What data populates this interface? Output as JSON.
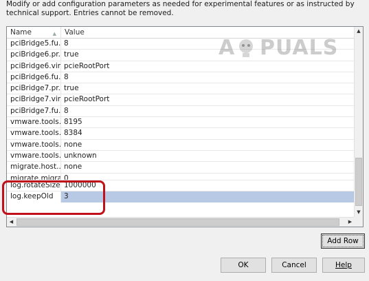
{
  "description": "Modify or add configuration parameters as needed for experimental features or as instructed by technical support. Entries cannot be removed.",
  "columns": {
    "name": "Name",
    "value": "Value"
  },
  "rows": [
    {
      "name": "pciBridge5.fu...",
      "value": "8"
    },
    {
      "name": "pciBridge6.pr...",
      "value": "true"
    },
    {
      "name": "pciBridge6.vir...",
      "value": "pcieRootPort"
    },
    {
      "name": "pciBridge6.fu...",
      "value": "8"
    },
    {
      "name": "pciBridge7.pr...",
      "value": "true"
    },
    {
      "name": "pciBridge7.vir...",
      "value": "pcieRootPort"
    },
    {
      "name": "pciBridge7.fu...",
      "value": "8"
    },
    {
      "name": "vmware.tools....",
      "value": "8195"
    },
    {
      "name": "vmware.tools....",
      "value": "8384"
    },
    {
      "name": "vmware.tools....",
      "value": "none"
    },
    {
      "name": "vmware.tools....",
      "value": "unknown"
    },
    {
      "name": "migrate.host...",
      "value": "none"
    },
    {
      "name": "migrate.migra...",
      "value": "0"
    },
    {
      "name": "log.rotateSize",
      "value": "1000000"
    },
    {
      "name": "log.keepOld",
      "value": "3"
    }
  ],
  "buttons": {
    "add_row": "Add Row",
    "ok": "OK",
    "cancel": "Cancel",
    "help": "Help"
  },
  "watermark": {
    "text_left": "A",
    "text_right": "PUALS"
  },
  "highlight_color": "#c0101a",
  "selection_color": "#b8c9e6"
}
